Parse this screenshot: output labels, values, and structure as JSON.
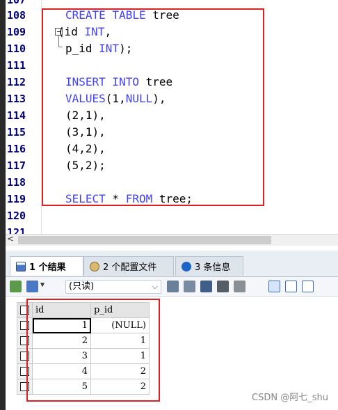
{
  "editor": {
    "line_numbers": [
      "107",
      "108",
      "109",
      "110",
      "111",
      "112",
      "113",
      "114",
      "115",
      "116",
      "117",
      "118",
      "119",
      "120",
      "121"
    ],
    "code": [
      {
        "kw": "CREATE TABLE",
        "rest": " tree"
      },
      {
        "kw": "",
        "rest": "(id ",
        "kw2": "INT",
        "rest2": ","
      },
      {
        "kw": "",
        "rest": "p_id ",
        "kw2": "INT",
        "rest2": ");"
      },
      {
        "kw": "INSERT INTO",
        "rest": " tree"
      },
      {
        "kw": "VALUES",
        "rest": "(1,",
        "kw2": "NULL",
        "rest2": "),"
      },
      {
        "kw": "",
        "rest": "(2,1),"
      },
      {
        "kw": "",
        "rest": "(3,1),"
      },
      {
        "kw": "",
        "rest": "(4,2),"
      },
      {
        "kw": "",
        "rest": "(5,2);"
      },
      {
        "kw": "SELECT",
        "rest": " * ",
        "kw2": "FROM",
        "rest2": " tree;"
      }
    ]
  },
  "scroll": {
    "arrow": "<"
  },
  "tabs": [
    {
      "label": "1 个结果",
      "icon": "grid-result-icon",
      "active": true
    },
    {
      "label": "2 个配置文件",
      "icon": "profile-icon",
      "active": false
    },
    {
      "label": "3 条信息",
      "icon": "info-icon",
      "active": false
    }
  ],
  "toolbar": {
    "readonly_label": "(只读)",
    "dropdown_arrow": "⌵"
  },
  "grid": {
    "columns": [
      "id",
      "p_id"
    ],
    "rows": [
      [
        "1",
        "(NULL)"
      ],
      [
        "2",
        "1"
      ],
      [
        "3",
        "1"
      ],
      [
        "4",
        "2"
      ],
      [
        "5",
        "2"
      ]
    ]
  },
  "watermark": "CSDN @阿七_shu",
  "colors": {
    "keyword": "#4040ff",
    "line_number": "#000080",
    "highlight_box": "#e02020"
  }
}
